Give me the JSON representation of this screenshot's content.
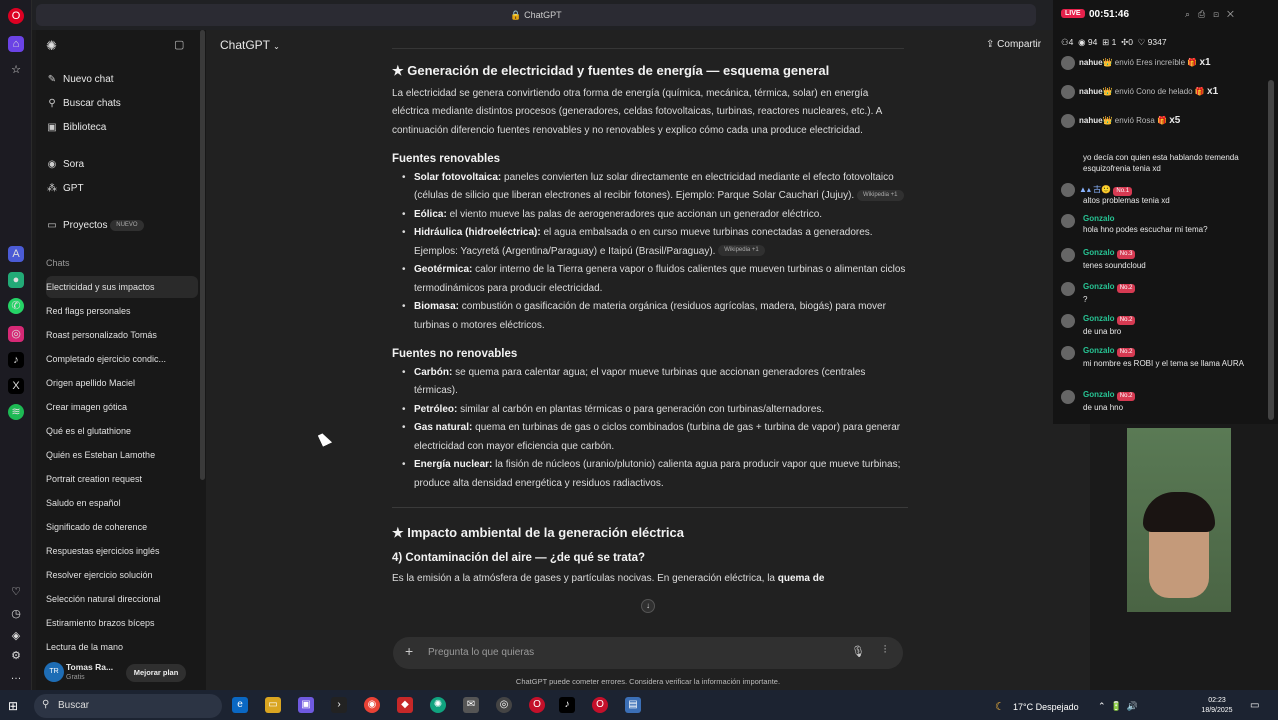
{
  "browser": {
    "url": "ChatGPT"
  },
  "sidebar": {
    "new_chat": "Nuevo chat",
    "search": "Buscar chats",
    "library": "Biblioteca",
    "sora": "Sora",
    "gpt": "GPT",
    "projects": "Proyectos",
    "projects_badge": "NUEVO",
    "chats_heading": "Chats",
    "items": [
      "Electricidad y sus impactos",
      "Red flags personales",
      "Roast personalizado Tomás",
      "Completado ejercicio condic...",
      "Origen apellido Maciel",
      "Crear imagen gótica",
      "Qué es el glutathione",
      "Quién es Esteban Lamothe",
      "Portrait creation request",
      "Saludo en español",
      "Significado de coherence",
      "Respuestas ejercicios inglés",
      "Resolver ejercicio solución",
      "Selección natural direccional",
      "Estiramiento brazos bíceps",
      "Lectura de la mano"
    ],
    "user_name": "Tomas Ra...",
    "user_plan": "Gratis",
    "user_initials": "TR",
    "upgrade": "Mejorar plan"
  },
  "header": {
    "model": "ChatGPT",
    "share": "Compartir"
  },
  "content": {
    "h1": "★ Generación de electricidad y fuentes de energía — esquema general",
    "intro": "La electricidad se genera convirtiendo otra forma de energía (química, mecánica, térmica, solar) en energía eléctrica mediante distintos procesos (generadores, celdas fotovoltaicas, turbinas, reactores nucleares, etc.). A continuación diferencio fuentes renovables y no renovables y explico cómo cada una produce electricidad.",
    "renew_h": "Fuentes renovables",
    "renew": [
      {
        "t": "Solar fotovoltaica:",
        "d": " paneles convierten luz solar directamente en electricidad mediante el efecto fotovoltaico (células de silicio que liberan electrones al recibir fotones). Ejemplo: Parque Solar Cauchari (Jujuy).",
        "chip": "Wikipedia +1"
      },
      {
        "t": "Eólica:",
        "d": " el viento mueve las palas de aerogeneradores que accionan un generador eléctrico.",
        "chip": ""
      },
      {
        "t": "Hidráulica (hidroeléctrica):",
        "d": " el agua embalsada o en curso mueve turbinas conectadas a generadores. Ejemplos: Yacyretá (Argentina/Paraguay) e Itaipú (Brasil/Paraguay).",
        "chip": "Wikipedia +1"
      },
      {
        "t": "Geotérmica:",
        "d": " calor interno de la Tierra genera vapor o fluidos calientes que mueven turbinas o alimentan ciclos termodinámicos para producir electricidad.",
        "chip": ""
      },
      {
        "t": "Biomasa:",
        "d": " combustión o gasificación de materia orgánica (residuos agrícolas, madera, biogás) para mover turbinas o motores eléctricos.",
        "chip": ""
      }
    ],
    "nonrenew_h": "Fuentes no renovables",
    "nonrenew": [
      {
        "t": "Carbón:",
        "d": " se quema para calentar agua; el vapor mueve turbinas que accionan generadores (centrales térmicas)."
      },
      {
        "t": "Petróleo:",
        "d": " similar al carbón en plantas térmicas o para generación con turbinas/alternadores."
      },
      {
        "t": "Gas natural:",
        "d": " quema en turbinas de gas o ciclos combinados (turbina de gas + turbina de vapor) para generar electricidad con mayor eficiencia que carbón."
      },
      {
        "t": "Energía nuclear:",
        "d": " la fisión de núcleos (uranio/plutonio) calienta agua para producir vapor que mueve turbinas; produce alta densidad energética y residuos radiactivos."
      }
    ],
    "h2": "★ Impacto ambiental de la generación eléctrica",
    "h2sub": "4) Contaminación del aire — ¿de qué se trata?",
    "last_pre": "Es la emisión a la atmósfera de gases y partículas nocivas. En generación eléctrica, la ",
    "last_bold": "quema de"
  },
  "composer": {
    "placeholder": "Pregunta lo que quieras"
  },
  "footer": "ChatGPT puede cometer errores. Considera verificar la información importante.",
  "live": {
    "badge": "LIVE",
    "timer": "00:51:46",
    "stats": [
      "4",
      "94",
      "1",
      "0",
      "9347"
    ],
    "gifts": [
      {
        "user": "nahue👑",
        "text": "envió Eres increíble",
        "count": "x1"
      },
      {
        "user": "nahue👑",
        "text": "envió Cono de helado",
        "count": "x1"
      },
      {
        "user": "nahue👑",
        "text": "envió Rosa",
        "count": "x5"
      }
    ],
    "msg1": "yo decía con quien esta hablando tremenda esquizofrenia tenia xd",
    "msg2_badge": "No.1",
    "msg2": "altos problemas tenia xd",
    "chats": [
      {
        "user": "Gonzalo",
        "badge": "",
        "text": "hola hno podes escuchar mi tema?"
      },
      {
        "user": "Gonzalo",
        "badge": "No.3",
        "text": "tenes soundcloud"
      },
      {
        "user": "Gonzalo",
        "badge": "No.2",
        "text": "?"
      },
      {
        "user": "Gonzalo",
        "badge": "No.2",
        "text": "de una bro"
      },
      {
        "user": "Gonzalo",
        "badge": "No.2",
        "text": "mi nombre es ROBI y el tema se llama AURA"
      },
      {
        "user": "Gonzalo",
        "badge": "No.2",
        "text": "de una hno"
      }
    ]
  },
  "taskbar": {
    "search": "Buscar",
    "weather": "17°C",
    "weather_text": "Despejado",
    "time": "02:23",
    "date": "18/9/2025"
  }
}
